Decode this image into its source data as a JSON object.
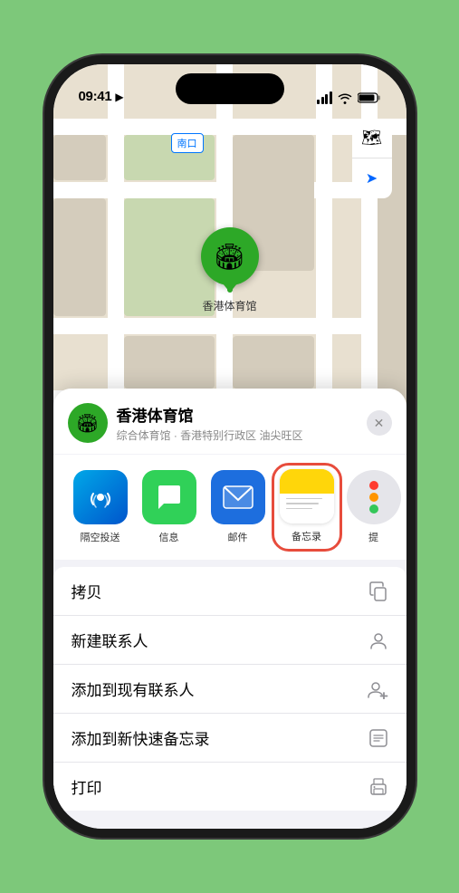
{
  "status": {
    "time": "09:41",
    "location_arrow": "▶"
  },
  "map": {
    "location_label": "南口",
    "map_icon": "🗺",
    "compass_icon": "➤",
    "venue_pin_label": "香港体育馆",
    "pin_emoji": "🏟"
  },
  "sheet": {
    "venue_name": "香港体育馆",
    "venue_sub": "综合体育馆 · 香港特别行政区 油尖旺区",
    "close_label": "✕"
  },
  "share_items": [
    {
      "id": "airdrop",
      "label": "隔空投送",
      "icon": "📡"
    },
    {
      "id": "messages",
      "label": "信息",
      "icon": "💬"
    },
    {
      "id": "mail",
      "label": "邮件",
      "icon": "✉️"
    },
    {
      "id": "notes",
      "label": "备忘录",
      "icon": ""
    }
  ],
  "more_item": {
    "label": "提"
  },
  "actions": [
    {
      "id": "copy",
      "label": "拷贝",
      "icon": "⧉"
    },
    {
      "id": "new-contact",
      "label": "新建联系人",
      "icon": "👤"
    },
    {
      "id": "add-existing",
      "label": "添加到现有联系人",
      "icon": "👤+"
    },
    {
      "id": "quick-note",
      "label": "添加到新快速备忘录",
      "icon": "📋"
    },
    {
      "id": "print",
      "label": "打印",
      "icon": "🖨"
    }
  ]
}
